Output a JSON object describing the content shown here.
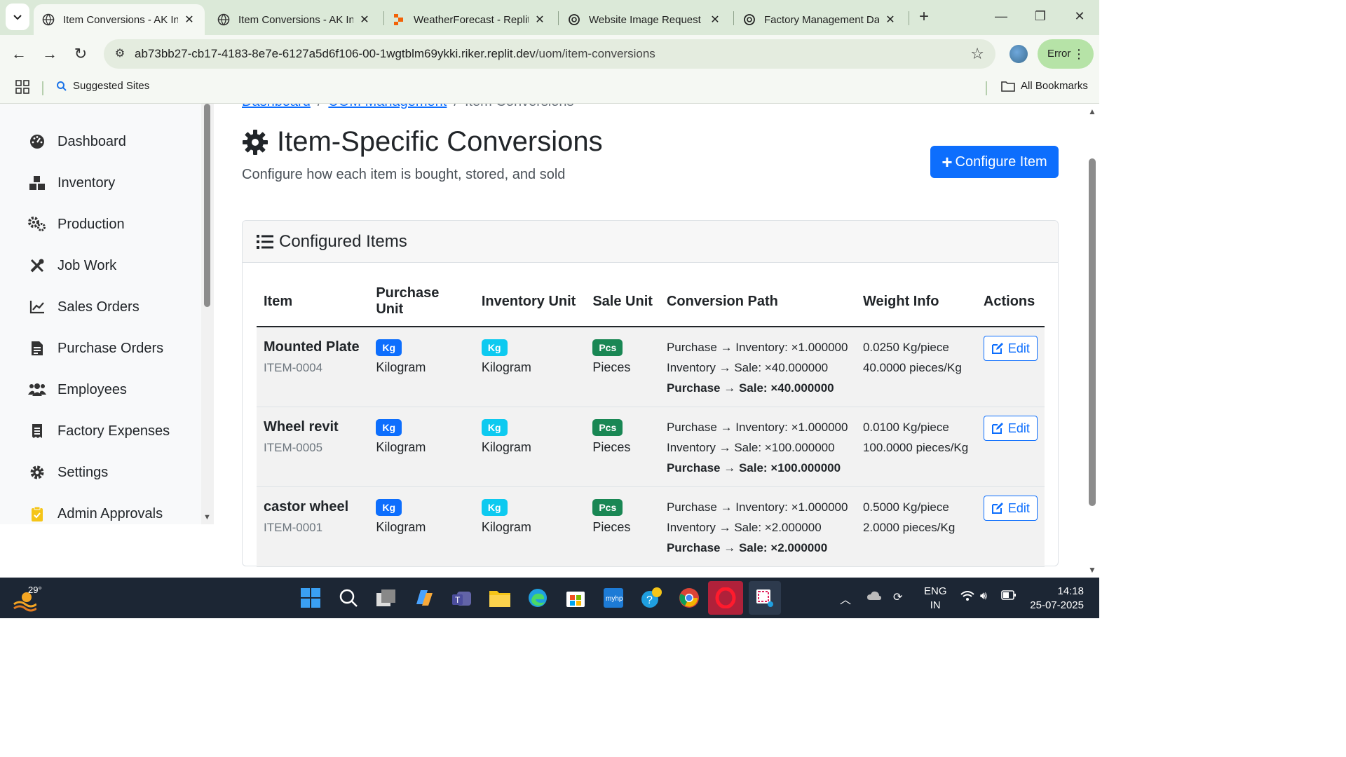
{
  "browser": {
    "tabs": [
      {
        "title": "Item Conversions - AK Innovations",
        "icon": "replit-globe-icon",
        "active": true
      },
      {
        "title": "Item Conversions - AK Innovations",
        "icon": "globe-icon",
        "active": false
      },
      {
        "title": "WeatherForecast - Replit",
        "icon": "replit-icon",
        "active": false
      },
      {
        "title": "Website Image Request",
        "icon": "chatgpt-icon",
        "active": false
      },
      {
        "title": "Factory Management Dashboard",
        "icon": "chatgpt-icon",
        "active": false
      }
    ],
    "url_host": "ab73bb27-cb17-4183-8e7e-6127a5d6f106-00-1wgtblm69ykki.riker.replit.dev",
    "url_path": "/uom/item-conversions",
    "profile_status": "Error",
    "bookmarks": {
      "suggested": "Suggested Sites",
      "all": "All Bookmarks"
    }
  },
  "sidebar": {
    "items": [
      {
        "label": "Dashboard",
        "icon": "gauge-icon"
      },
      {
        "label": "Inventory",
        "icon": "boxes-icon"
      },
      {
        "label": "Production",
        "icon": "cogs-icon"
      },
      {
        "label": "Job Work",
        "icon": "tools-icon"
      },
      {
        "label": "Sales Orders",
        "icon": "chart-line-icon"
      },
      {
        "label": "Purchase Orders",
        "icon": "file-invoice-icon"
      },
      {
        "label": "Employees",
        "icon": "users-icon"
      },
      {
        "label": "Factory Expenses",
        "icon": "receipt-icon"
      },
      {
        "label": "Settings",
        "icon": "gear-icon"
      },
      {
        "label": "Admin Approvals",
        "icon": "clipboard-check-icon"
      }
    ]
  },
  "breadcrumb": {
    "home": "Dashboard",
    "parent": "UOM Management",
    "current": "Item Conversions",
    "separator": "/"
  },
  "header": {
    "title": "Item-Specific Conversions",
    "subtitle": "Configure how each item is bought, stored, and sold",
    "configure_button": "Configure Item"
  },
  "card": {
    "title": "Configured Items",
    "columns": [
      "Item",
      "Purchase Unit",
      "Inventory Unit",
      "Sale Unit",
      "Conversion Path",
      "Weight Info",
      "Actions"
    ],
    "rows": [
      {
        "name": "Mounted Plate",
        "code": "ITEM-0004",
        "purchase_badge": "Kg",
        "purchase_unit": "Kilogram",
        "inventory_badge": "Kg",
        "inventory_unit": "Kilogram",
        "sale_badge": "Pcs",
        "sale_unit": "Pieces",
        "conv1": "Purchase → Inventory: ×1.000000",
        "conv2": "Inventory → Sale: ×40.000000",
        "conv3": "Purchase → Sale: ×40.000000",
        "weight1": "0.0250 Kg/piece",
        "weight2": "40.0000 pieces/Kg",
        "action": "Edit"
      },
      {
        "name": "Wheel revit",
        "code": "ITEM-0005",
        "purchase_badge": "Kg",
        "purchase_unit": "Kilogram",
        "inventory_badge": "Kg",
        "inventory_unit": "Kilogram",
        "sale_badge": "Pcs",
        "sale_unit": "Pieces",
        "conv1": "Purchase → Inventory: ×1.000000",
        "conv2": "Inventory → Sale: ×100.000000",
        "conv3": "Purchase → Sale: ×100.000000",
        "weight1": "0.0100 Kg/piece",
        "weight2": "100.0000 pieces/Kg",
        "action": "Edit"
      },
      {
        "name": "castor wheel",
        "code": "ITEM-0001",
        "purchase_badge": "Kg",
        "purchase_unit": "Kilogram",
        "inventory_badge": "Kg",
        "inventory_unit": "Kilogram",
        "sale_badge": "Pcs",
        "sale_unit": "Pieces",
        "conv1": "Purchase → Inventory: ×1.000000",
        "conv2": "Inventory → Sale: ×2.000000",
        "conv3": "Purchase → Sale: ×2.000000",
        "weight1": "0.5000 Kg/piece",
        "weight2": "2.0000 pieces/Kg",
        "action": "Edit"
      }
    ]
  },
  "taskbar": {
    "temperature": "29°",
    "language": "ENG",
    "region": "IN",
    "time": "14:18",
    "date": "25-07-2025"
  },
  "colors": {
    "primary": "#0d6efd",
    "info": "#0dcaf0",
    "success": "#198754",
    "chrome_green": "#dbe9d8"
  }
}
